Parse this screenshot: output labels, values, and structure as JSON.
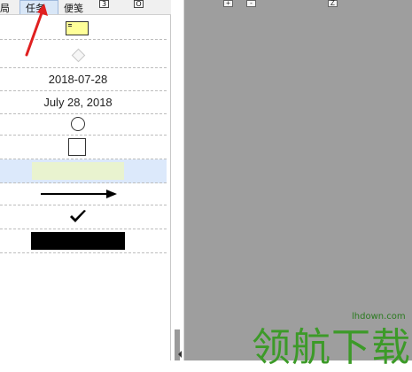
{
  "tabs": [
    {
      "label": "局"
    },
    {
      "label": "任务"
    },
    {
      "label": "便笺"
    }
  ],
  "toolbar_mini": {
    "b1": "3",
    "b2": "O"
  },
  "rows": {
    "date_numeric": "2018-07-28",
    "date_long": "July 28, 2018"
  },
  "canvas_buttons": {
    "plus": "+",
    "minus": "-",
    "z": "Z"
  },
  "watermark": {
    "url": "lhdown.com",
    "text": "领航下载"
  },
  "colors": {
    "note": "#ffff99",
    "highlight_row": "#dce9fb",
    "green_bar": "#e9f3cf",
    "canvas_bg": "#9e9e9e",
    "arrow_annotation": "#e02020"
  }
}
